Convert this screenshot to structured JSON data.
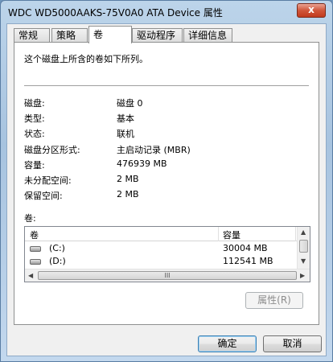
{
  "window": {
    "title": "WDC WD5000AAKS-75V0A0 ATA Device 属性",
    "close_label": "x"
  },
  "tabs": [
    {
      "label": "常规",
      "active": false
    },
    {
      "label": "策略",
      "active": false
    },
    {
      "label": "卷",
      "active": true
    },
    {
      "label": "驱动程序",
      "active": false
    },
    {
      "label": "详细信息",
      "active": false
    }
  ],
  "panel": {
    "intro": "这个磁盘上所含的卷如下所列。",
    "properties": [
      {
        "key": "磁盘:",
        "value": "磁盘 0"
      },
      {
        "key": "类型:",
        "value": "基本"
      },
      {
        "key": "状态:",
        "value": "联机"
      },
      {
        "key": "磁盘分区形式:",
        "value": "主启动记录 (MBR)"
      },
      {
        "key": "容量:",
        "value": "476939 MB"
      },
      {
        "key": "未分配空间:",
        "value": "2 MB"
      },
      {
        "key": "保留空间:",
        "value": "2 MB"
      }
    ],
    "volumes_label": "卷:",
    "columns": {
      "volume": "卷",
      "capacity": "容量"
    },
    "volumes": [
      {
        "name": "(C:)",
        "capacity": "30004 MB",
        "icon": "drive-icon"
      },
      {
        "name": "(D:)",
        "capacity": "112541 MB",
        "icon": "drive-icon"
      }
    ],
    "hscroll_grip": "III",
    "properties_button": "属性(R)"
  },
  "footer": {
    "ok_label": "确定",
    "cancel_label": "取消"
  }
}
